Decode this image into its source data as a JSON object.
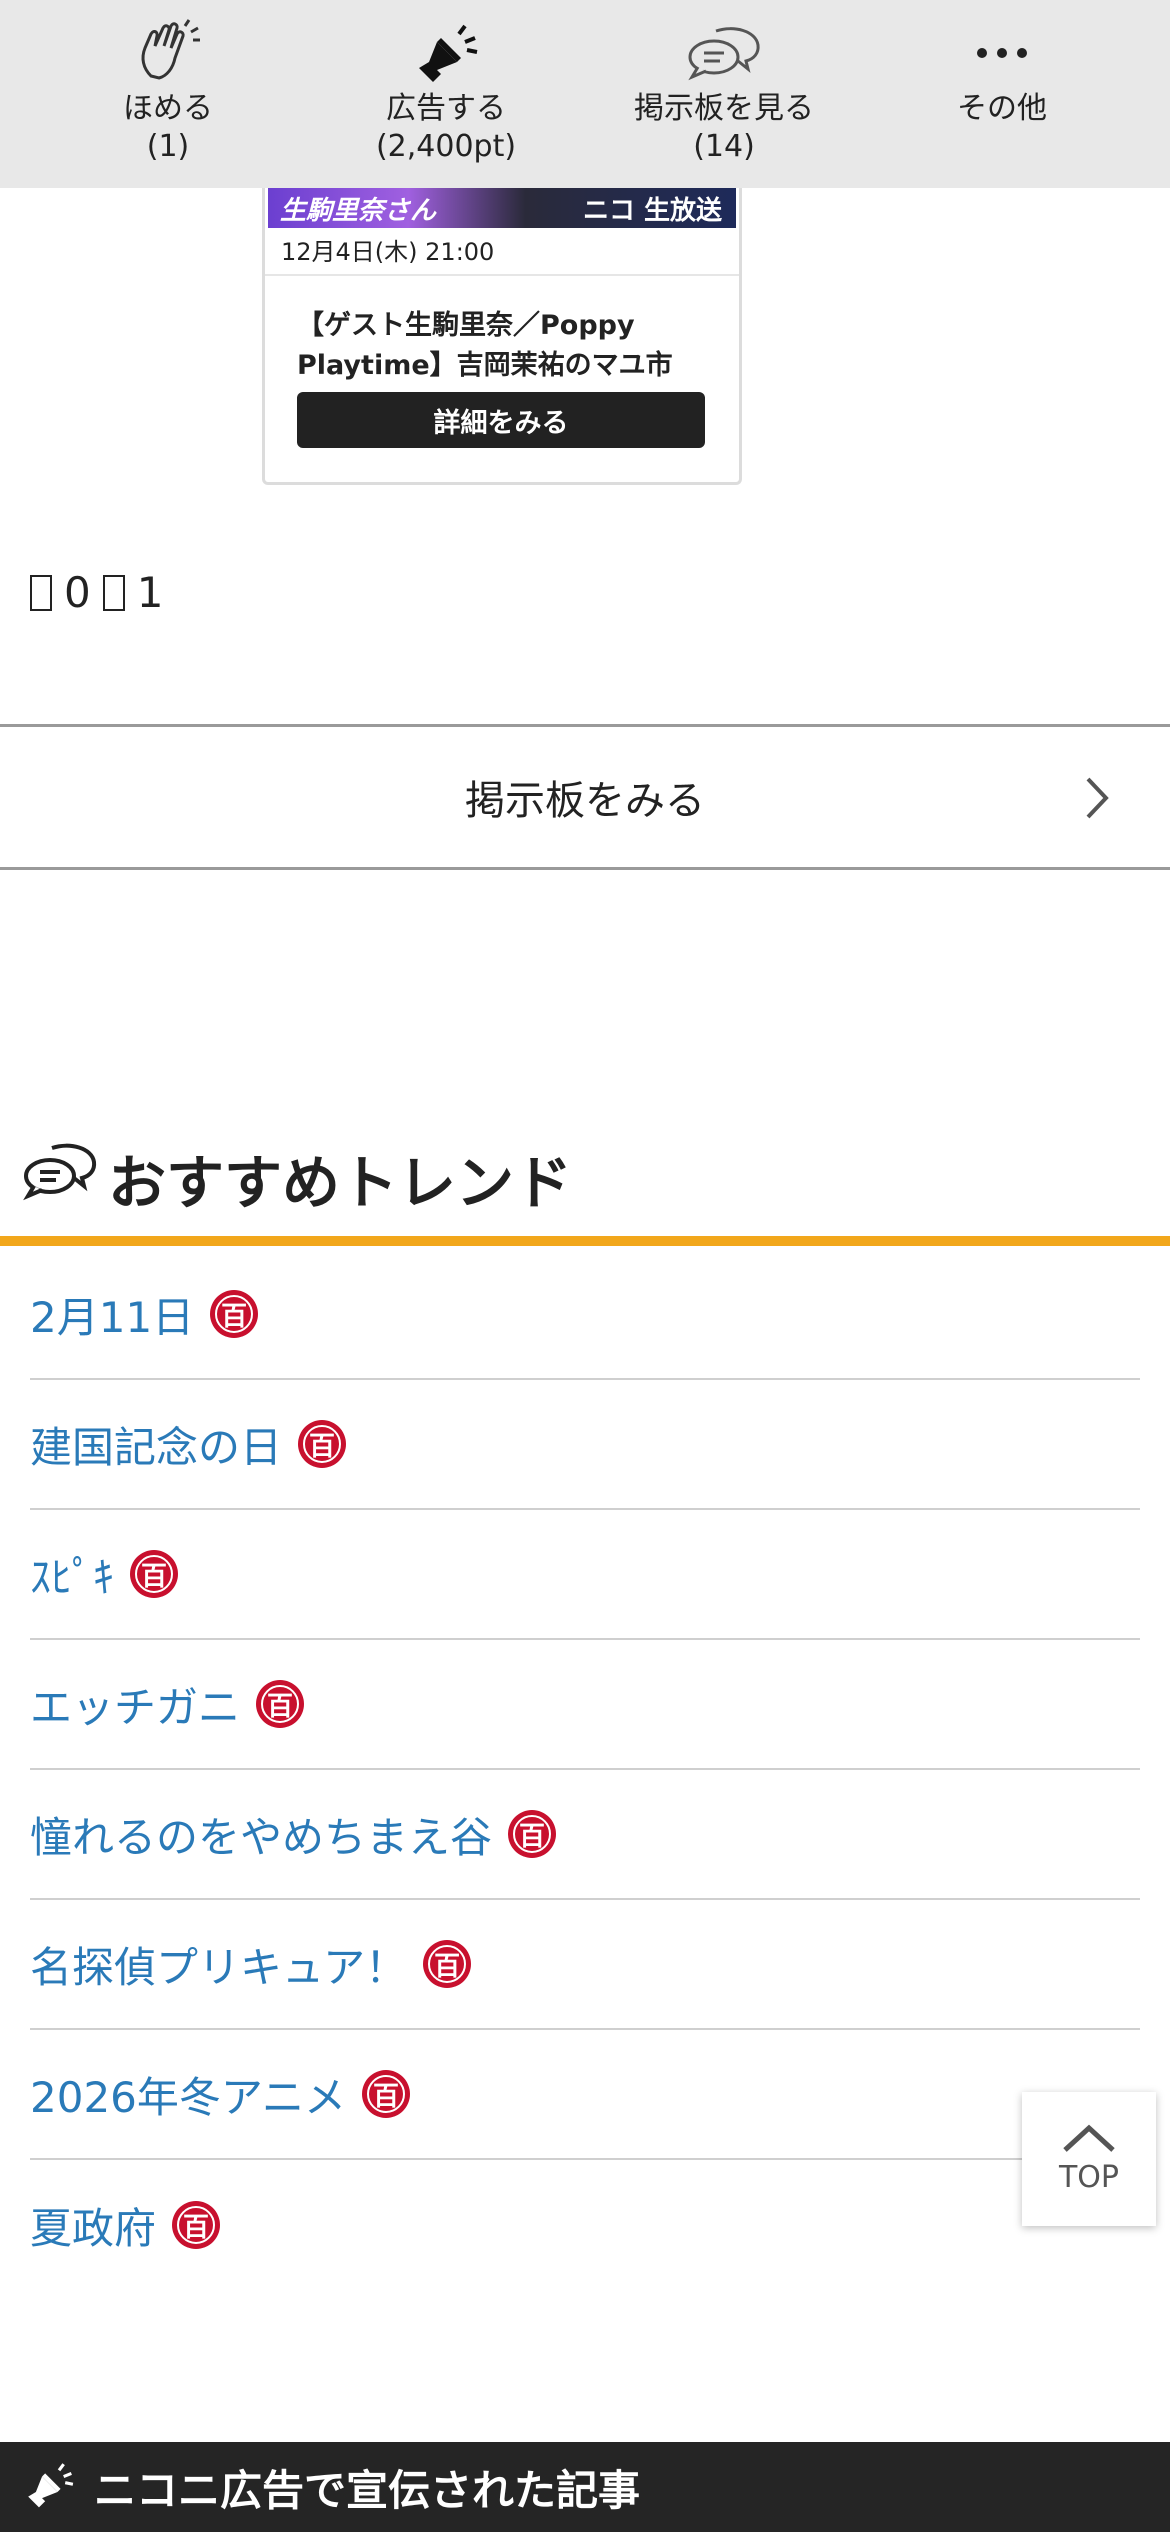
{
  "action_bar": {
    "praise": {
      "label": "ほめる",
      "count": "(1)"
    },
    "advertise": {
      "label": "広告する",
      "count": "(2,400pt)"
    },
    "board": {
      "label": "掲示板を見る",
      "count": "(14)"
    },
    "more": {
      "label": "その他",
      "count": ""
    }
  },
  "ad_card": {
    "thumb_name": "生駒里奈さん",
    "thumb_right": "ニコ 生放送",
    "date": "12月4日(木) 21:00",
    "title": "【ゲスト生駒里奈／Poppy Playtime】吉岡茉祐のマユ市",
    "button": "詳細をみる"
  },
  "counter": {
    "value_a": "0",
    "value_b": "1"
  },
  "bbs_link": {
    "label": "掲示板をみる"
  },
  "trends": {
    "heading": "おすすめトレンド",
    "badge_char": "百",
    "items": [
      {
        "label": "2月11日"
      },
      {
        "label": "建国記念の日"
      },
      {
        "label": "ｽﾋﾟｷ"
      },
      {
        "label": "エッチガニ"
      },
      {
        "label": "憧れるのをやめちまえ谷"
      },
      {
        "label": "名探偵プリキュア！"
      },
      {
        "label": "2026年冬アニメ"
      },
      {
        "label": "夏政府"
      }
    ]
  },
  "top_button": {
    "label": "TOP"
  },
  "footer": {
    "label": "ニコニ広告で宣伝された記事"
  },
  "colors": {
    "accent_orange": "#f2a71b",
    "link_blue": "#2a7ab8",
    "badge_red": "#c8102e",
    "footer_bg": "#252525"
  }
}
